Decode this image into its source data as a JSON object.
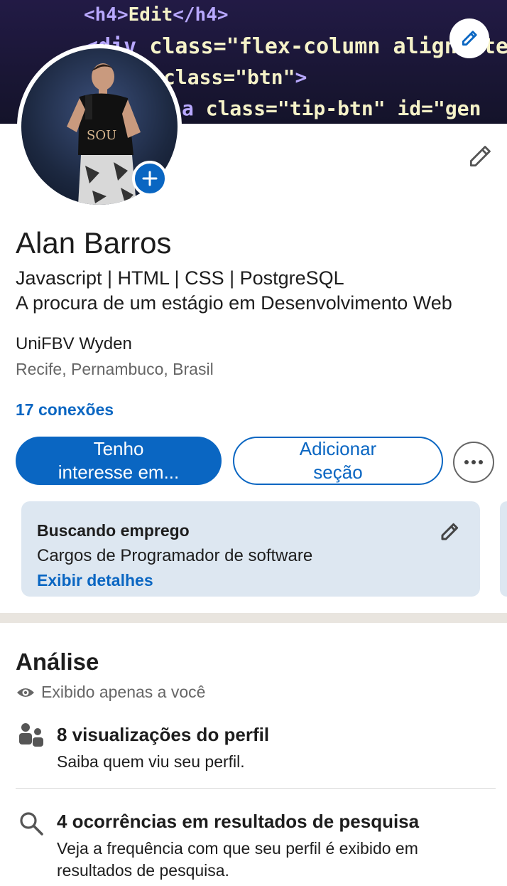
{
  "banner": {
    "code_lines": [
      {
        "open": "<h4>",
        "text": "Edit",
        "close": "</h4>"
      },
      {
        "open": "<div ",
        "text": "class=\"flex-column align-iter",
        "close": ""
      },
      {
        "open": "",
        "text": "class=\"btn\"",
        "close": ">"
      },
      {
        "open": "a ",
        "text": "class=\"tip-btn\" id=\"gen",
        "close": ""
      }
    ]
  },
  "profile": {
    "name": "Alan Barros",
    "headline_line1": "Javascript | HTML | CSS | PostgreSQL",
    "headline_line2": "A procura de um estágio em Desenvolvimento Web",
    "education": "UniFBV Wyden",
    "location": "Recife, Pernambuco, Brasil",
    "connections": "17 conexões",
    "avatar_shirt_text": "SOU"
  },
  "actions": {
    "primary_line1": "Tenho",
    "primary_line2": "interesse em...",
    "secondary_line1": "Adicionar",
    "secondary_line2": "seção"
  },
  "open_to_work": {
    "title": "Buscando emprego",
    "text": "Cargos de Programador de software",
    "link": "Exibir detalhes"
  },
  "analytics": {
    "title": "Análise",
    "visibility": "Exibido apenas a você",
    "items": [
      {
        "title": "8 visualizações do perfil",
        "subtitle": "Saiba quem viu seu perfil."
      },
      {
        "title": "4 ocorrências em resultados de pesquisa",
        "subtitle": "Veja a frequência com que seu perfil é exibido em resultados de pesquisa."
      }
    ]
  },
  "colors": {
    "accent": "#0a66c2",
    "card_bg": "#dde7f1",
    "muted_text": "#666666"
  },
  "icons": [
    "pencil-icon",
    "plus-icon",
    "more-icon",
    "eye-icon",
    "people-icon",
    "search-icon"
  ]
}
